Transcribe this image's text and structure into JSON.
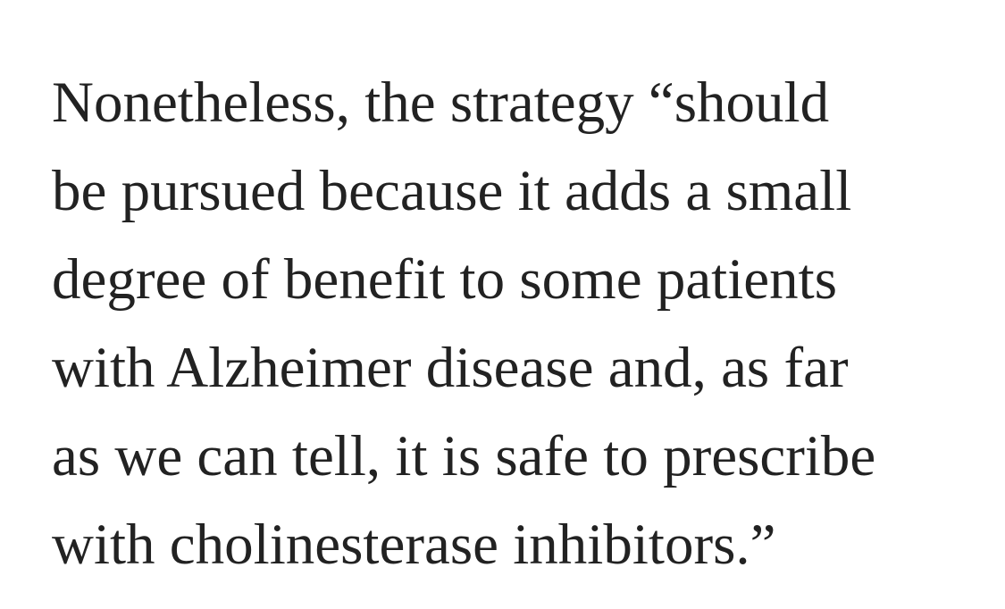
{
  "article": {
    "paragraph_lines": [
      "Nonetheless, the strategy “should",
      "be pursued because it adds a small",
      "degree of benefit to some patients",
      "with Alzheimer disease and, as far",
      "as we can tell, it is safe to prescribe",
      "with cholinesterase inhibitors.”"
    ]
  },
  "colors": {
    "text": "#222222",
    "background": "#ffffff"
  }
}
